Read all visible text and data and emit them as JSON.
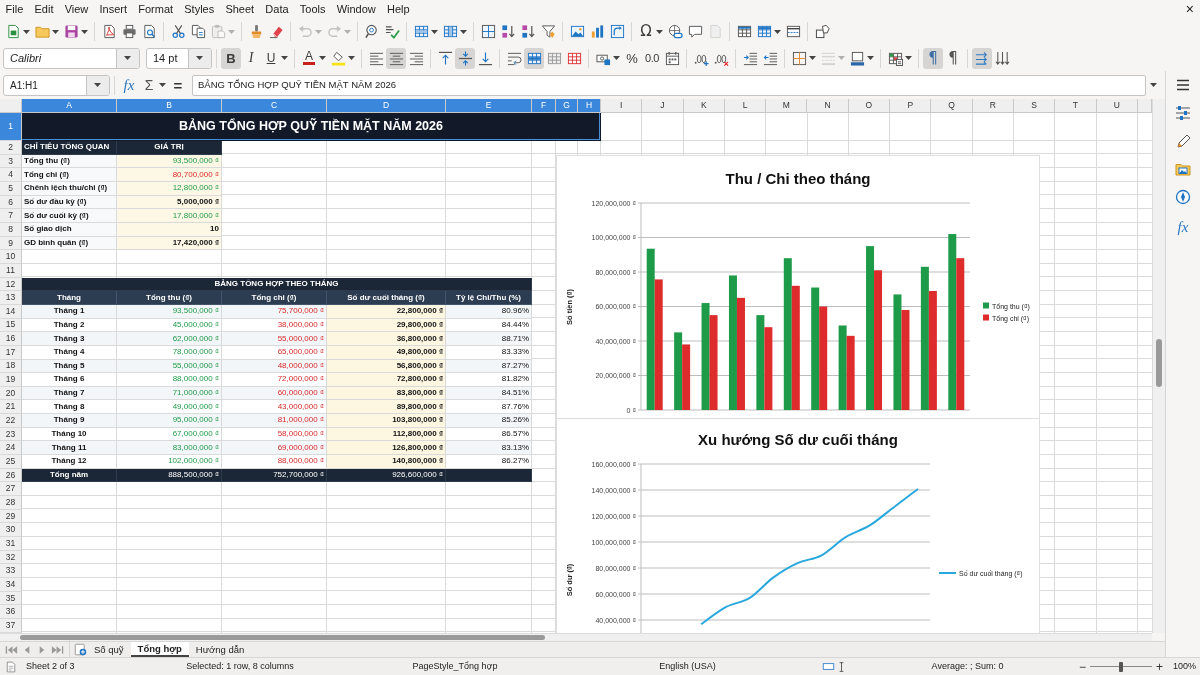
{
  "menu_bar": {
    "items": [
      "File",
      "Edit",
      "View",
      "Insert",
      "Format",
      "Styles",
      "Sheet",
      "Data",
      "Tools",
      "Window",
      "Help"
    ],
    "close": "×"
  },
  "standard_toolbar": {
    "groups": [
      [
        {
          "kind": "new",
          "dropdown": true,
          "disabled": false
        },
        {
          "kind": "open",
          "dropdown": true,
          "disabled": false
        },
        {
          "kind": "save",
          "dropdown": true,
          "disabled": false
        }
      ],
      [
        {
          "kind": "export_pdf",
          "disabled": false
        },
        {
          "kind": "print",
          "disabled": false
        },
        {
          "kind": "print_preview",
          "disabled": false
        }
      ],
      [
        {
          "kind": "cut",
          "disabled": false
        },
        {
          "kind": "copy",
          "disabled": false
        },
        {
          "kind": "paste",
          "dropdown": true,
          "disabled": true
        }
      ],
      [
        {
          "kind": "clone_formatting",
          "disabled": false
        },
        {
          "kind": "clear_formatting",
          "disabled": false
        }
      ],
      [
        {
          "kind": "undo",
          "dropdown": true,
          "disabled": true
        },
        {
          "kind": "redo",
          "dropdown": true,
          "disabled": true
        }
      ],
      [
        {
          "kind": "find_replace",
          "disabled": false
        },
        {
          "kind": "spelling",
          "disabled": false
        }
      ],
      [
        {
          "kind": "row",
          "dropdown": true,
          "disabled": false
        },
        {
          "kind": "column",
          "dropdown": true,
          "disabled": false
        }
      ],
      [
        {
          "kind": "sort",
          "disabled": false
        },
        {
          "kind": "sort_ascending",
          "disabled": false
        },
        {
          "kind": "sort_descending",
          "disabled": false
        },
        {
          "kind": "autofilter",
          "disabled": false
        }
      ],
      [
        {
          "kind": "image",
          "disabled": false
        },
        {
          "kind": "chart",
          "disabled": false
        },
        {
          "kind": "pivot_table",
          "disabled": false
        }
      ],
      [
        {
          "kind": "special_character",
          "label": "Ω",
          "dropdown": true,
          "disabled": false
        },
        {
          "kind": "hyperlink",
          "disabled": false
        },
        {
          "kind": "comment",
          "disabled": false
        },
        {
          "kind": "headers_footers",
          "disabled": true
        }
      ],
      [
        {
          "kind": "print_area",
          "disabled": false
        },
        {
          "kind": "freeze",
          "dropdown": true,
          "disabled": false
        },
        {
          "kind": "split_window",
          "disabled": false
        }
      ],
      [
        {
          "kind": "draw_functions",
          "disabled": false
        }
      ]
    ]
  },
  "formatting_toolbar": {
    "font_name": "Calibri",
    "font_size": "14 pt",
    "groups": [
      [
        {
          "kind": "bold",
          "label": "B",
          "on": true,
          "disabled": false
        },
        {
          "kind": "italic",
          "label": "I",
          "on": false,
          "disabled": false
        },
        {
          "kind": "underline",
          "label": "U",
          "dropdown": true,
          "on": false,
          "disabled": false
        }
      ],
      [
        {
          "kind": "font_color",
          "label": "A",
          "dropdown": true,
          "on": false,
          "disabled": false
        },
        {
          "kind": "highlight",
          "dropdown": true,
          "on": false,
          "disabled": false
        }
      ],
      [
        {
          "kind": "align_left",
          "on": false,
          "disabled": false
        },
        {
          "kind": "align_center",
          "on": true,
          "disabled": false
        },
        {
          "kind": "align_right",
          "on": false,
          "disabled": false
        }
      ],
      [
        {
          "kind": "align_top",
          "on": false,
          "disabled": false
        },
        {
          "kind": "align_middle",
          "on": true,
          "disabled": false
        },
        {
          "kind": "align_bottom",
          "on": false,
          "disabled": false
        }
      ],
      [
        {
          "kind": "wrap_text",
          "on": false,
          "disabled": false
        },
        {
          "kind": "merge_center",
          "on": true,
          "disabled": false
        },
        {
          "kind": "merge_cells",
          "on": false,
          "disabled": false
        },
        {
          "kind": "unmerge_cells",
          "on": false,
          "disabled": false
        }
      ],
      [
        {
          "kind": "currency",
          "dropdown": true,
          "on": false,
          "disabled": false
        },
        {
          "kind": "percent",
          "label": "%",
          "on": false,
          "disabled": false
        },
        {
          "kind": "number",
          "label": "0.0",
          "on": false,
          "disabled": false
        },
        {
          "kind": "date",
          "on": false,
          "disabled": false
        }
      ],
      [
        {
          "kind": "add_decimal",
          "on": false,
          "disabled": false
        },
        {
          "kind": "delete_decimal",
          "on": false,
          "disabled": false
        }
      ],
      [
        {
          "kind": "indent_more",
          "on": false,
          "disabled": false
        },
        {
          "kind": "indent_less",
          "on": false,
          "disabled": false
        }
      ],
      [
        {
          "kind": "borders",
          "dropdown": true,
          "on": false,
          "disabled": false
        },
        {
          "kind": "border_style",
          "dropdown": true,
          "on": false,
          "disabled": true
        },
        {
          "kind": "border_color",
          "dropdown": true,
          "on": false,
          "disabled": false
        }
      ],
      [
        {
          "kind": "conditional",
          "dropdown": true,
          "on": false,
          "disabled": false
        }
      ],
      [
        {
          "kind": "ltr",
          "label": "¶",
          "on": true,
          "disabled": false
        },
        {
          "kind": "rtl",
          "label": "¶",
          "on": false,
          "disabled": false
        }
      ],
      [
        {
          "kind": "text_ltr",
          "on": true,
          "disabled": false
        },
        {
          "kind": "text_vertical",
          "on": false,
          "disabled": false
        }
      ]
    ]
  },
  "formula_bar": {
    "name_box": "A1:H1",
    "function_wizard": "fx",
    "sum": "Σ",
    "equals": "=",
    "content": "BẢNG TỔNG HỢP QUỸ TIỀN MẶT NĂM 2026"
  },
  "sidebar": {
    "functions": "fx"
  },
  "sheet": {
    "columns": [
      {
        "label": "A",
        "selected": true
      },
      {
        "label": "B",
        "selected": true
      },
      {
        "label": "C",
        "selected": true
      },
      {
        "label": "D",
        "selected": true
      },
      {
        "label": "E",
        "selected": true
      },
      {
        "label": "F",
        "selected": true
      },
      {
        "label": "G",
        "selected": true
      },
      {
        "label": "H",
        "selected": true
      },
      {
        "label": "I",
        "selected": false
      },
      {
        "label": "J",
        "selected": false
      },
      {
        "label": "K",
        "selected": false
      },
      {
        "label": "L",
        "selected": false
      },
      {
        "label": "M",
        "selected": false
      },
      {
        "label": "N",
        "selected": false
      },
      {
        "label": "O",
        "selected": false
      },
      {
        "label": "P",
        "selected": false
      },
      {
        "label": "Q",
        "selected": false
      },
      {
        "label": "R",
        "selected": false
      },
      {
        "label": "S",
        "selected": false
      },
      {
        "label": "T",
        "selected": false
      },
      {
        "label": "U",
        "selected": false
      }
    ],
    "rows": [
      {
        "label": "1",
        "selected": true
      },
      {
        "label": "2",
        "selected": false
      },
      {
        "label": "3",
        "selected": false
      },
      {
        "label": "4",
        "selected": false
      },
      {
        "label": "5",
        "selected": false
      },
      {
        "label": "6",
        "selected": false
      },
      {
        "label": "7",
        "selected": false
      },
      {
        "label": "8",
        "selected": false
      },
      {
        "label": "9",
        "selected": false
      },
      {
        "label": "10",
        "selected": false
      },
      {
        "label": "11",
        "selected": false
      },
      {
        "label": "12",
        "selected": false
      },
      {
        "label": "13",
        "selected": false
      },
      {
        "label": "14",
        "selected": false
      },
      {
        "label": "15",
        "selected": false
      },
      {
        "label": "16",
        "selected": false
      },
      {
        "label": "17",
        "selected": false
      },
      {
        "label": "18",
        "selected": false
      },
      {
        "label": "19",
        "selected": false
      },
      {
        "label": "20",
        "selected": false
      },
      {
        "label": "21",
        "selected": false
      },
      {
        "label": "22",
        "selected": false
      },
      {
        "label": "23",
        "selected": false
      },
      {
        "label": "24",
        "selected": false
      },
      {
        "label": "25",
        "selected": false
      },
      {
        "label": "26",
        "selected": false
      },
      {
        "label": "27",
        "selected": false
      },
      {
        "label": "28",
        "selected": false
      },
      {
        "label": "29",
        "selected": false
      },
      {
        "label": "30",
        "selected": false
      },
      {
        "label": "31",
        "selected": false
      },
      {
        "label": "32",
        "selected": false
      },
      {
        "label": "33",
        "selected": false
      },
      {
        "label": "34",
        "selected": false
      },
      {
        "label": "35",
        "selected": false
      },
      {
        "label": "36",
        "selected": false
      },
      {
        "label": "37",
        "selected": false
      }
    ],
    "title": "BẢNG TỔNG HỢP QUỸ TIỀN MẶT NĂM 2026",
    "overview": {
      "headers": [
        "CHỈ TIÊU TỔNG QUAN",
        "GIÁ TRỊ"
      ],
      "items": [
        {
          "label": "Tổng thu (₫)",
          "value": "93,500,000 ₫",
          "kind": "positive"
        },
        {
          "label": "Tổng chi (₫)",
          "value": "80,700,000 ₫",
          "kind": "negative"
        },
        {
          "label": "Chênh lệch thu/chi (₫)",
          "value": "12,800,000 ₫",
          "kind": "positive"
        },
        {
          "label": "Số dư đầu kỳ (₫)",
          "value": "5,000,000 ₫",
          "kind": "plain"
        },
        {
          "label": "Số dư cuối kỳ (₫)",
          "value": "17,800,000 ₫",
          "kind": "positive"
        },
        {
          "label": "Số giao dịch",
          "value": "10",
          "kind": "plain"
        },
        {
          "label": "GD bình quân (₫)",
          "value": "17,420,000 ₫",
          "kind": "plain"
        }
      ]
    },
    "monthly": {
      "title": "BẢNG TỔNG HỢP THEO THÁNG",
      "headers": [
        "Tháng",
        "Tổng thu (₫)",
        "Tổng chi (₫)",
        "Số dư cuối tháng (₫)",
        "Tỷ lệ Chi/Thu (%)"
      ],
      "rows": [
        [
          "Tháng 1",
          "93,500,000 ₫",
          "75,700,000 ₫",
          "22,800,000 ₫",
          "80.96%"
        ],
        [
          "Tháng 2",
          "45,000,000 ₫",
          "38,000,000 ₫",
          "29,800,000 ₫",
          "84.44%"
        ],
        [
          "Tháng 3",
          "62,000,000 ₫",
          "55,000,000 ₫",
          "36,800,000 ₫",
          "88.71%"
        ],
        [
          "Tháng 4",
          "78,000,000 ₫",
          "65,000,000 ₫",
          "49,800,000 ₫",
          "83.33%"
        ],
        [
          "Tháng 5",
          "55,000,000 ₫",
          "48,000,000 ₫",
          "56,800,000 ₫",
          "87.27%"
        ],
        [
          "Tháng 6",
          "88,000,000 ₫",
          "72,000,000 ₫",
          "72,800,000 ₫",
          "81.82%"
        ],
        [
          "Tháng 7",
          "71,000,000 ₫",
          "60,000,000 ₫",
          "83,800,000 ₫",
          "84.51%"
        ],
        [
          "Tháng 8",
          "49,000,000 ₫",
          "43,000,000 ₫",
          "89,800,000 ₫",
          "87.76%"
        ],
        [
          "Tháng 9",
          "95,000,000 ₫",
          "81,000,000 ₫",
          "103,800,000 ₫",
          "85.26%"
        ],
        [
          "Tháng 10",
          "67,000,000 ₫",
          "58,000,000 ₫",
          "112,800,000 ₫",
          "86.57%"
        ],
        [
          "Tháng 11",
          "83,000,000 ₫",
          "69,000,000 ₫",
          "126,800,000 ₫",
          "83.13%"
        ],
        [
          "Tháng 12",
          "102,000,000 ₫",
          "88,000,000 ₫",
          "140,800,000 ₫",
          "86.27%"
        ]
      ],
      "total": [
        "Tổng năm",
        "888,500,000 ₫",
        "752,700,000 ₫",
        "926,600,000 ₫"
      ]
    }
  },
  "charts": [
    {
      "chart_data": {
        "type": "bar",
        "title": "Thu / Chi theo tháng",
        "ylabel": "Số tiền (₫)",
        "series": [
          {
            "name": "Tổng thu (₫)",
            "color": "#1e9b48",
            "values": [
              93500000,
              45000000,
              62000000,
              78000000,
              55000000,
              88000000,
              71000000,
              49000000,
              95000000,
              67000000,
              83000000,
              102000000
            ]
          },
          {
            "name": "Tổng chi (₫)",
            "color": "#de2b2b",
            "values": [
              75700000,
              38000000,
              55000000,
              65000000,
              48000000,
              72000000,
              60000000,
              43000000,
              81000000,
              58000000,
              69000000,
              88000000
            ]
          }
        ],
        "ylim": [
          0,
          120000000
        ],
        "yticks": [
          {
            "value": 0,
            "label": "0 ₫"
          },
          {
            "value": 20000000,
            "label": "20,000,000 ₫"
          },
          {
            "value": 40000000,
            "label": "40,000,000 ₫"
          },
          {
            "value": 60000000,
            "label": "60,000,000 ₫"
          },
          {
            "value": 80000000,
            "label": "80,000,000 ₫"
          },
          {
            "value": 100000000,
            "label": "100,000,000 ₫"
          },
          {
            "value": 120000000,
            "label": "120,000,000 ₫"
          }
        ],
        "grid": true,
        "legend": "right"
      }
    },
    {
      "chart_data": {
        "type": "line",
        "title": "Xu hướng Số dư cuối tháng",
        "ylabel": "Số dư (₫)",
        "series": [
          {
            "name": "Số dư cuối tháng (₫)",
            "color": "#29a8dd",
            "values": [
              null,
              null,
              36800000,
              49800000,
              56800000,
              72800000,
              83800000,
              89800000,
              103800000,
              112800000,
              126800000,
              140800000
            ]
          }
        ],
        "ylim": [
          30000000,
          160000000
        ],
        "yticks": [
          {
            "value": 40000000,
            "label": "40,000,000 ₫"
          },
          {
            "value": 60000000,
            "label": "60,000,000 ₫"
          },
          {
            "value": 80000000,
            "label": "80,000,000 ₫"
          },
          {
            "value": 100000000,
            "label": "100,000,000 ₫"
          },
          {
            "value": 120000000,
            "label": "120,000,000 ₫"
          },
          {
            "value": 140000000,
            "label": "140,000,000 ₫"
          },
          {
            "value": 160000000,
            "label": "160,000,000 ₫"
          }
        ],
        "grid": true,
        "legend": "right"
      }
    }
  ],
  "sheet_tabs": [
    {
      "label": "Số quỹ",
      "selected": false
    },
    {
      "label": "Tổng hợp",
      "selected": true
    },
    {
      "label": "Hướng dẫn",
      "selected": false
    }
  ],
  "status_bar": {
    "sheet": "Sheet 2 of 3",
    "selection": "Selected: 1 row, 8 columns",
    "page_style": "PageStyle_Tổng hợp",
    "language": "English (USA)",
    "summary": "Average: ; Sum: 0",
    "zoom": {
      "minus": "−",
      "plus": "+",
      "level": 0.5,
      "reading": "100%"
    }
  }
}
